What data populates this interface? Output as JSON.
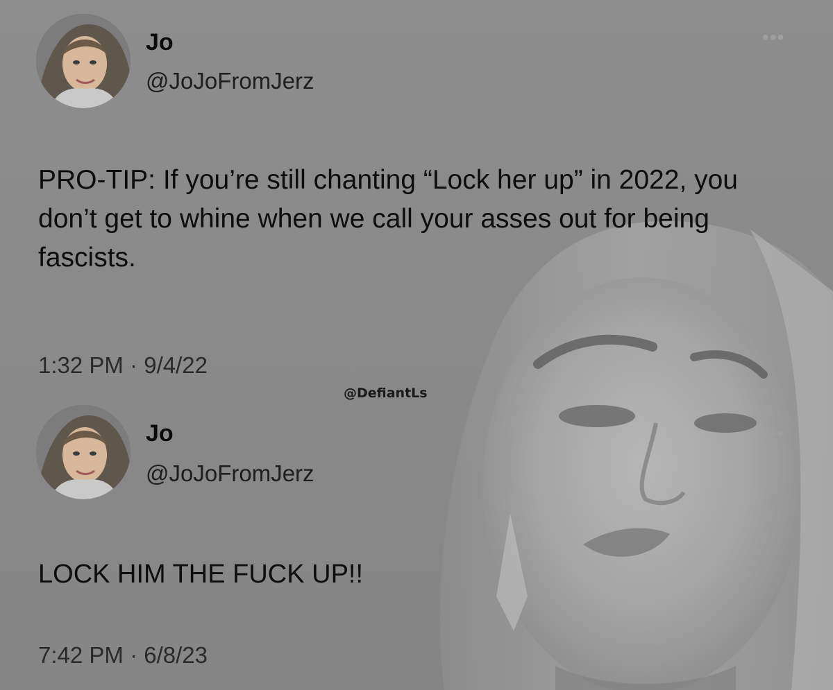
{
  "tweets": [
    {
      "display_name": "Jo",
      "handle": "@JoJoFromJerz",
      "more_icon": "more-options-icon",
      "text": "PRO-TIP: If you’re still chanting “Lock her up” in 2022, you don’t get to whine when we call your asses out for being fascists.",
      "timestamp": "1:32 PM · 9/4/22"
    },
    {
      "display_name": "Jo",
      "handle": "@JoJoFromJerz",
      "more_icon": "more-options-icon",
      "text": "LOCK HIM THE FUCK UP!!",
      "timestamp": "7:42 PM · 6/8/23"
    }
  ],
  "watermark": "@DefiantLs",
  "colors": {
    "background": "#8a8a8a",
    "text": "#0c0c0c"
  }
}
